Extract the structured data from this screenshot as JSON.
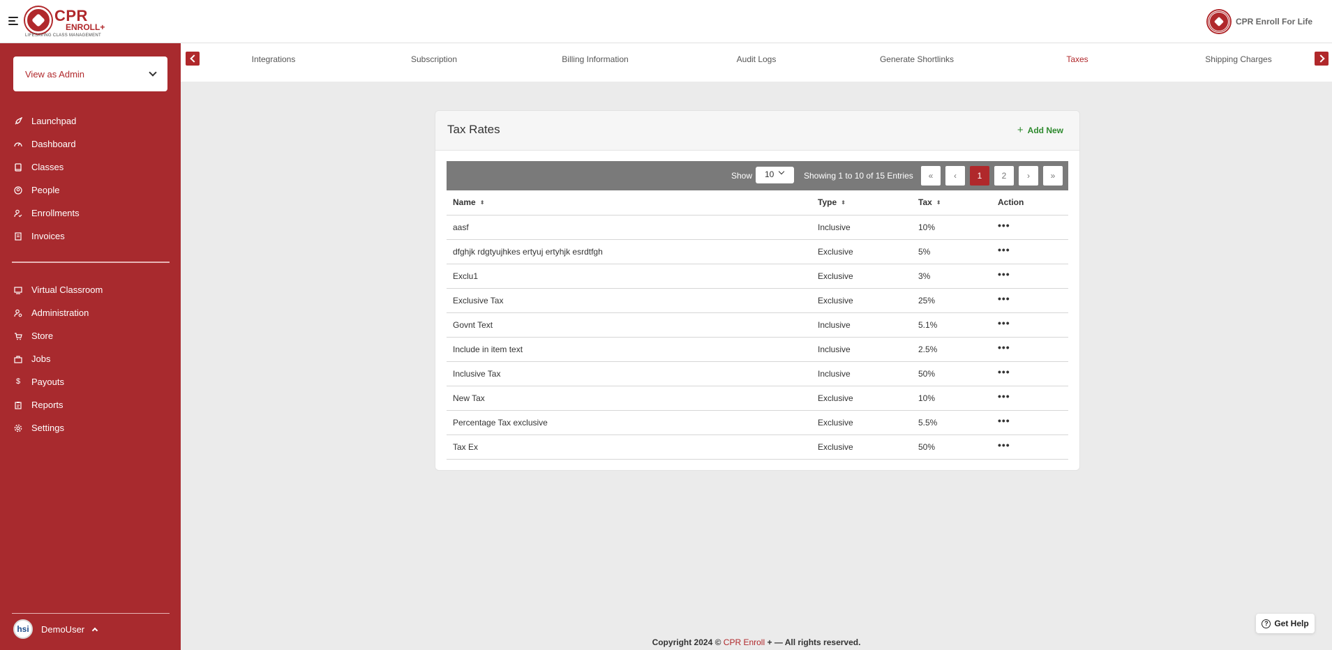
{
  "header": {
    "brand_cpr": "CPR",
    "brand_enroll": "ENROLL+",
    "brand_tagline": "LIFESAVING CLASS MANAGEMENT",
    "org_name": "CPR Enroll For Life"
  },
  "sidebar": {
    "view_select": "View as Admin",
    "nav_primary": [
      {
        "label": "Launchpad",
        "icon": "rocket-icon"
      },
      {
        "label": "Dashboard",
        "icon": "gauge-icon"
      },
      {
        "label": "Classes",
        "icon": "book-icon"
      },
      {
        "label": "People",
        "icon": "user-circle-icon"
      },
      {
        "label": "Enrollments",
        "icon": "user-check-icon"
      },
      {
        "label": "Invoices",
        "icon": "invoice-icon"
      }
    ],
    "nav_secondary": [
      {
        "label": "Virtual Classroom",
        "icon": "screen-icon"
      },
      {
        "label": "Administration",
        "icon": "admin-icon"
      },
      {
        "label": "Store",
        "icon": "cart-icon"
      },
      {
        "label": "Jobs",
        "icon": "briefcase-icon"
      },
      {
        "label": "Payouts",
        "icon": "dollar-icon"
      },
      {
        "label": "Reports",
        "icon": "clipboard-icon"
      },
      {
        "label": "Settings",
        "icon": "gear-icon"
      }
    ],
    "user": {
      "avatar": "hsi",
      "name": "DemoUser"
    }
  },
  "tabs": [
    "Integrations",
    "Subscription",
    "Billing Information",
    "Audit Logs",
    "Generate Shortlinks",
    "Taxes",
    "Shipping Charges"
  ],
  "active_tab": "Taxes",
  "card": {
    "title": "Tax Rates",
    "add_new": "Add New",
    "show_label": "Show",
    "page_size": "10",
    "entries_text": "Showing 1 to 10 of 15 Entries",
    "pager": [
      "«",
      "‹",
      "1",
      "2",
      "›",
      "»"
    ],
    "current_page": "1",
    "columns": [
      "Name",
      "Type",
      "Tax",
      "Action"
    ],
    "rows": [
      {
        "name": "aasf",
        "type": "Inclusive",
        "tax": "10%"
      },
      {
        "name": "dfghjk rdgtyujhkes ertyuj ertyhjk esrdtfgh",
        "type": "Exclusive",
        "tax": "5%"
      },
      {
        "name": "Exclu1",
        "type": "Exclusive",
        "tax": "3%"
      },
      {
        "name": "Exclusive Tax",
        "type": "Exclusive",
        "tax": "25%"
      },
      {
        "name": "Govnt Text",
        "type": "Inclusive",
        "tax": "5.1%"
      },
      {
        "name": "Include in item text",
        "type": "Inclusive",
        "tax": "2.5%"
      },
      {
        "name": "Inclusive Tax",
        "type": "Inclusive",
        "tax": "50%"
      },
      {
        "name": "New Tax",
        "type": "Exclusive",
        "tax": "10%"
      },
      {
        "name": "Percentage Tax exclusive",
        "type": "Exclusive",
        "tax": "5.5%"
      },
      {
        "name": "Tax Ex",
        "type": "Exclusive",
        "tax": "50%"
      }
    ],
    "action_glyph": "•••"
  },
  "footer": {
    "prefix": "Copyright 2024 ©",
    "brand": "CPR Enroll",
    "suffix": "+ — All rights reserved."
  },
  "help": {
    "label": "Get Help"
  },
  "colors": {
    "brand": "#a82a2e",
    "accent": "#b0282b",
    "add_new": "#2e8a2e",
    "toolbar": "#7a7a7a",
    "page_bg": "#ebebeb"
  }
}
